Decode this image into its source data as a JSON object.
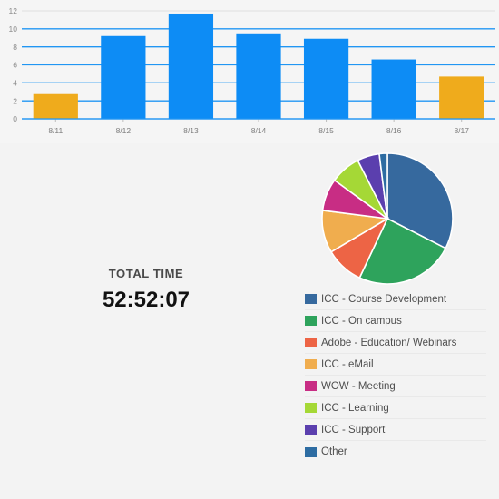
{
  "total_time": {
    "label": "TOTAL TIME",
    "value": "52:52:07"
  },
  "colors": {
    "bar_blue": "#0d8cf5",
    "bar_orange": "#efab1c",
    "gridline": "#2196f3",
    "top_gridline": "#e0e0e0",
    "panel_bg": "#f5f5f5",
    "page_bg": "#f3f3f3"
  },
  "chart_data": [
    {
      "type": "bar",
      "title": "",
      "xlabel": "",
      "ylabel": "",
      "categories": [
        "8/11",
        "8/12",
        "8/13",
        "8/14",
        "8/15",
        "8/16",
        "8/17"
      ],
      "values": [
        2.75,
        9.2,
        11.7,
        9.5,
        8.9,
        6.6,
        4.7
      ],
      "bar_colors": [
        "#efab1c",
        "#0d8cf5",
        "#0d8cf5",
        "#0d8cf5",
        "#0d8cf5",
        "#0d8cf5",
        "#efab1c"
      ],
      "ylim": [
        0,
        12
      ],
      "yticks": [
        0,
        2,
        4,
        6,
        8,
        10,
        12
      ],
      "ytick_labels": [
        "0",
        "2",
        "4",
        "6",
        "8",
        "10",
        "12"
      ],
      "grid": true,
      "legend": "none"
    },
    {
      "type": "pie",
      "title": "",
      "legend_position": "bottom",
      "labels": [
        "ICC - Course Development",
        "ICC - On campus",
        "Adobe - Education/ Webinars",
        "ICC - eMail",
        "WOW - Meeting",
        "ICC - Learning",
        "ICC - Support",
        "Other"
      ],
      "values": [
        32.5,
        24.5,
        9.5,
        10.5,
        8.0,
        7.5,
        5.5,
        2.0
      ],
      "colors": [
        "#36699e",
        "#2ea35c",
        "#ed6445",
        "#f0ad4e",
        "#c82d84",
        "#a5d836",
        "#5b3fae",
        "#2d6ca2"
      ]
    }
  ],
  "legend": {
    "items": [
      {
        "label": "ICC - Course Development",
        "color": "#36699e"
      },
      {
        "label": "ICC - On campus",
        "color": "#2ea35c"
      },
      {
        "label": "Adobe - Education/ Webinars",
        "color": "#ed6445"
      },
      {
        "label": "ICC - eMail",
        "color": "#f0ad4e"
      },
      {
        "label": "WOW - Meeting",
        "color": "#c82d84"
      },
      {
        "label": "ICC - Learning",
        "color": "#a5d836"
      },
      {
        "label": "ICC - Support",
        "color": "#5b3fae"
      },
      {
        "label": "Other",
        "color": "#2d6ca2"
      }
    ]
  }
}
